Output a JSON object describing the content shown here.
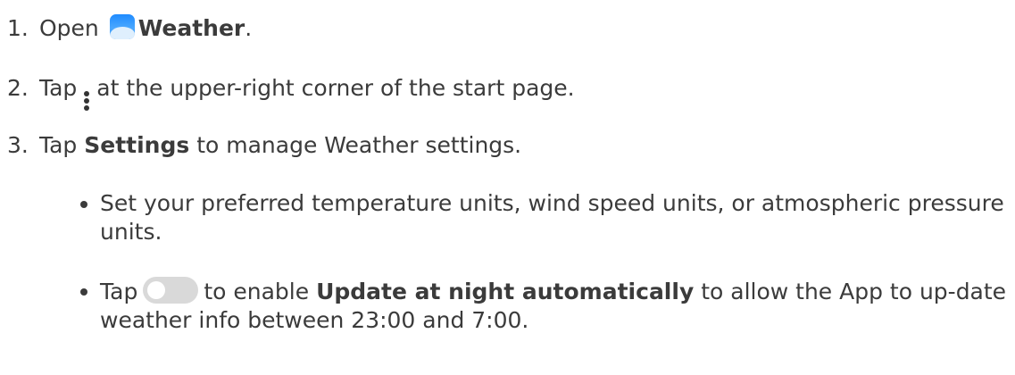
{
  "steps": [
    {
      "num": "1.",
      "pre": "Open",
      "icon": "weather-app-icon",
      "bold": "Weather",
      "post": "."
    },
    {
      "num": "2.",
      "pre": "Tap",
      "icon": "more-vertical-icon",
      "post": "at the upper-right corner of the start page."
    },
    {
      "num": "3.",
      "pre": "Tap",
      "bold": "Settings",
      "post": "to manage Weather settings."
    }
  ],
  "bullets": [
    {
      "text": "Set your preferred temperature units, wind speed units, or atmospheric pressure units."
    },
    {
      "pre": "Tap",
      "icon": "toggle-switch-icon",
      "pre2": "to enable",
      "bold": "Update at night automatically",
      "post": "to allow the App to up-date weather info between 23:00 and 7:00."
    }
  ],
  "colors": {
    "text": "#3b3b3b",
    "weather_icon": "#1f8bff",
    "toggle_track": "#d9d9d9"
  }
}
